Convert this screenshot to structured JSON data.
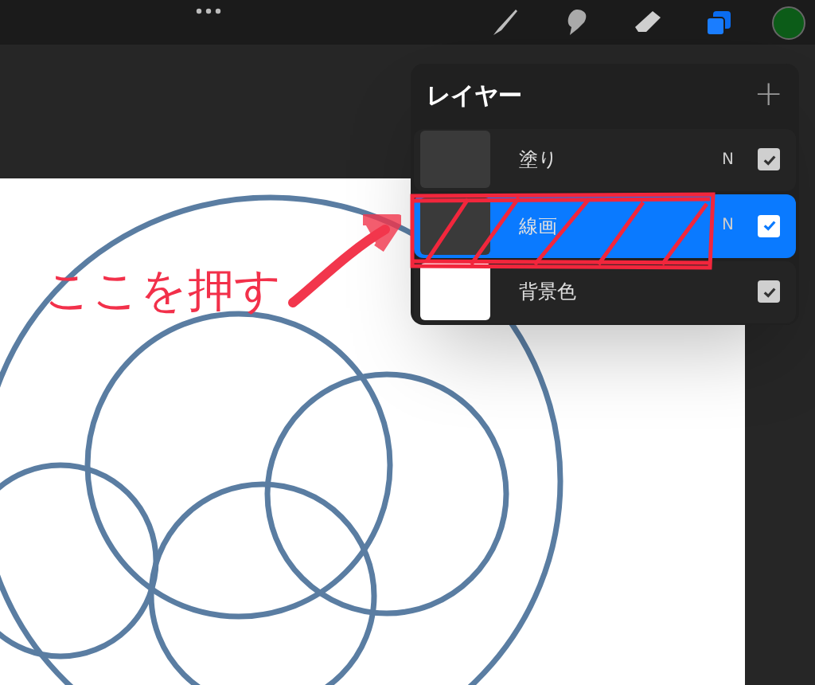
{
  "layers_panel": {
    "title": "レイヤー",
    "add_button": "+",
    "layers": [
      {
        "kind": "layer",
        "name": "塗り",
        "blend": "N",
        "visible": true,
        "selected": false
      },
      {
        "kind": "layer",
        "name": "線画",
        "blend": "N",
        "visible": true,
        "selected": true
      },
      {
        "kind": "background",
        "name": "背景色",
        "visible": true,
        "selected": false
      }
    ]
  },
  "annotation": {
    "text": "ここを押す"
  }
}
